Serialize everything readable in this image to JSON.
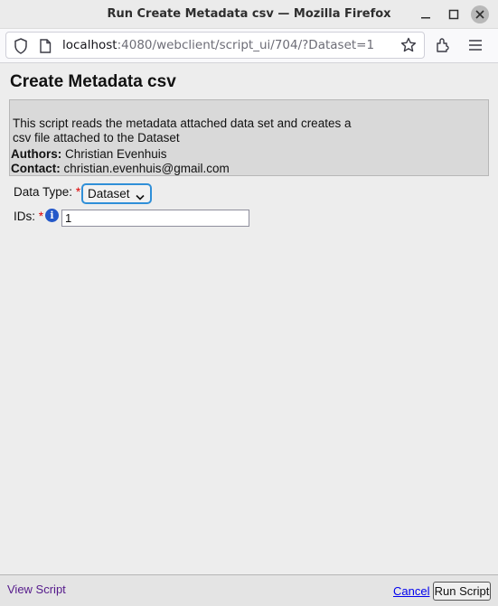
{
  "window": {
    "title": "Run Create Metadata csv — Mozilla Firefox",
    "minimize_icon": "minimize-icon",
    "maximize_icon": "maximize-icon",
    "close_icon": "close-icon"
  },
  "navbar": {
    "url_host": "localhost",
    "url_rest": ":4080/webclient/script_ui/704/?Dataset=1",
    "icons": [
      "shield-icon",
      "page-icon",
      "star-icon",
      "extensions-icon",
      "menu-icon"
    ]
  },
  "page": {
    "title": "Create Metadata csv",
    "description": "This script reads the metadata attached data set and creates a csv file attached to the Dataset",
    "authors_label": "Authors:",
    "authors_value": " Christian Evenhuis",
    "contact_label": "Contact:",
    "contact_value": " christian.evenhuis@gmail.com"
  },
  "form": {
    "data_type_label": "Data Type:",
    "required_mark": "*",
    "data_type_value": "Dataset",
    "ids_label": "IDs:",
    "ids_value": "1",
    "info_icon": "info-icon"
  },
  "footer": {
    "view_script": "View Script",
    "cancel": "Cancel",
    "run_script": "Run Script"
  },
  "colors": {
    "accent_focus": "#2f8fd8",
    "required": "#dd0000",
    "link_visited": "#551a8b",
    "link": "#0000ee",
    "info": "#2458c9"
  }
}
